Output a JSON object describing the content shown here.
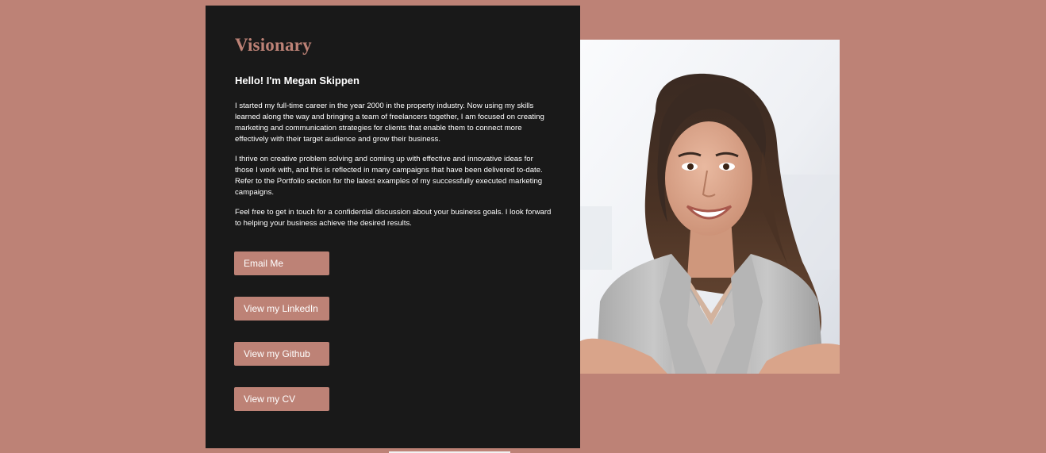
{
  "brand": "Visionary",
  "greeting": "Hello! I'm Megan Skippen",
  "bio": [
    "I started my full-time career in the year 2000 in the property industry. Now using my skills learned along the way and bringing a team of freelancers together, I am focused on creating marketing and communication strategies for clients that enable them to connect more effectively with their target audience and grow their business.",
    "I thrive on creative problem solving and coming up with effective and innovative ideas for those I work with, and this is reflected in many campaigns that have been delivered to-date. Refer to the Portfolio section for the latest examples of my successfully executed marketing campaigns.",
    "Feel free to get in touch for a confidential discussion about your business goals. I look forward to helping your business achieve the desired results."
  ],
  "buttons": {
    "email": "Email Me",
    "linkedin": "View my LinkedIn",
    "github": "View my Github",
    "cv": "View my CV"
  },
  "colors": {
    "page_background": "#bd8276",
    "card_background": "#191919",
    "accent": "#bd8276"
  }
}
